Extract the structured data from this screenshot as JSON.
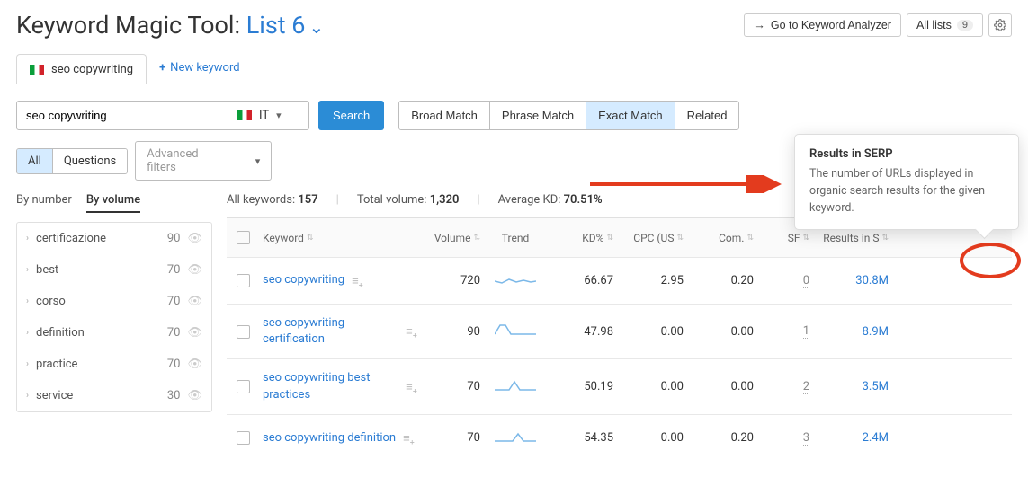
{
  "header": {
    "title_prefix": "Keyword Magic Tool: ",
    "list_name": "List 6",
    "go_analyzer": "Go to Keyword Analyzer",
    "all_lists": "All lists",
    "all_lists_count": "9"
  },
  "tabs": {
    "active_tab": "seo copywriting",
    "new_keyword": "New keyword"
  },
  "search": {
    "value": "seo copywriting",
    "country": "IT",
    "button": "Search"
  },
  "match": {
    "broad": "Broad Match",
    "phrase": "Phrase Match",
    "exact": "Exact Match",
    "related": "Related"
  },
  "filters": {
    "all": "All",
    "questions": "Questions",
    "advanced": "Advanced filters"
  },
  "sort": {
    "by_number": "By number",
    "by_volume": "By volume"
  },
  "sidebar": {
    "items": [
      {
        "label": "certificazione",
        "count": "90"
      },
      {
        "label": "best",
        "count": "70"
      },
      {
        "label": "corso",
        "count": "70"
      },
      {
        "label": "definition",
        "count": "70"
      },
      {
        "label": "practice",
        "count": "70"
      },
      {
        "label": "service",
        "count": "30"
      }
    ]
  },
  "stats": {
    "all_kw_label": "All keywords:",
    "all_kw_value": "157",
    "total_vol_label": "Total volume:",
    "total_vol_value": "1,320",
    "avg_kd_label": "Average KD:",
    "avg_kd_value": "70.51%"
  },
  "columns": {
    "keyword": "Keyword",
    "volume": "Volume",
    "trend": "Trend",
    "kd": "KD%",
    "cpc": "CPC (US",
    "com": "Com.",
    "sf": "SF",
    "results": "Results in S"
  },
  "rows": [
    {
      "keyword": "seo copywriting",
      "volume": "720",
      "kd": "66.67",
      "cpc": "2.95",
      "com": "0.20",
      "sf": "0",
      "results": "30.8M"
    },
    {
      "keyword": "seo copywriting certification",
      "volume": "90",
      "kd": "47.98",
      "cpc": "0.00",
      "com": "0.00",
      "sf": "1",
      "results": "8.9M"
    },
    {
      "keyword": "seo copywriting best practices",
      "volume": "70",
      "kd": "50.19",
      "cpc": "0.00",
      "com": "0.00",
      "sf": "2",
      "results": "3.5M"
    },
    {
      "keyword": "seo copywriting definition",
      "volume": "70",
      "kd": "54.35",
      "cpc": "0.00",
      "com": "0.20",
      "sf": "3",
      "results": "2.4M"
    }
  ],
  "tooltip": {
    "title": "Results in SERP",
    "body": "The number of URLs displayed in organic search results for the given keyword."
  }
}
